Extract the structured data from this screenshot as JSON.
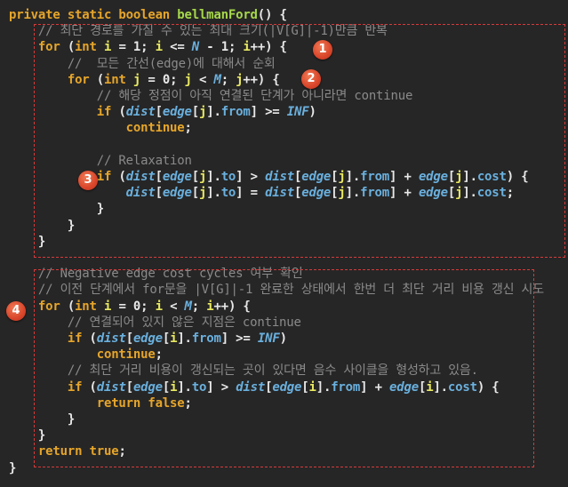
{
  "colors": {
    "background": "#262626",
    "keyword": "#e6a52a",
    "function": "#a6d84a",
    "variable": "#6ab0de",
    "index": "#e8e862",
    "comment": "#8a8a8a",
    "text": "#e8e8e8",
    "annotation": "#d83a3a"
  },
  "badges": [
    "1",
    "2",
    "3",
    "4"
  ],
  "lines": [
    [
      [
        "kw",
        "private static boolean "
      ],
      [
        "fn",
        "bellmanFord"
      ],
      [
        "punc",
        "() {"
      ]
    ],
    [
      [
        "cmt",
        "    // 최단 경로를 가질 수 있는 최대 크기(|V[G]|-1)만큼 반복"
      ]
    ],
    [
      [
        "punc",
        "    "
      ],
      [
        "kw",
        "for"
      ],
      [
        "punc",
        " ("
      ],
      [
        "kw",
        "int "
      ],
      [
        "idx",
        "i"
      ],
      [
        "op",
        " = "
      ],
      [
        "num",
        "1"
      ],
      [
        "punc",
        "; "
      ],
      [
        "idx",
        "i"
      ],
      [
        "op",
        " <= "
      ],
      [
        "var",
        "N"
      ],
      [
        "op",
        " - "
      ],
      [
        "num",
        "1"
      ],
      [
        "punc",
        "; "
      ],
      [
        "idx",
        "i"
      ],
      [
        "op",
        "++) {"
      ]
    ],
    [
      [
        "cmt",
        "        //  모든 간선(edge)에 대해서 순회"
      ]
    ],
    [
      [
        "punc",
        "        "
      ],
      [
        "kw",
        "for"
      ],
      [
        "punc",
        " ("
      ],
      [
        "kw",
        "int "
      ],
      [
        "idx",
        "j"
      ],
      [
        "op",
        " = "
      ],
      [
        "num",
        "0"
      ],
      [
        "punc",
        "; "
      ],
      [
        "idx",
        "j"
      ],
      [
        "op",
        " < "
      ],
      [
        "var",
        "M"
      ],
      [
        "punc",
        "; "
      ],
      [
        "idx",
        "j"
      ],
      [
        "op",
        "++) {"
      ]
    ],
    [
      [
        "cmt",
        "            // 해당 정점이 아직 연결된 단계가 아니라면 continue"
      ]
    ],
    [
      [
        "punc",
        "            "
      ],
      [
        "kw",
        "if"
      ],
      [
        "punc",
        " ("
      ],
      [
        "var",
        "dist"
      ],
      [
        "punc",
        "["
      ],
      [
        "var",
        "edge"
      ],
      [
        "punc",
        "["
      ],
      [
        "idx",
        "j"
      ],
      [
        "punc",
        "]."
      ],
      [
        "field",
        "from"
      ],
      [
        "punc",
        "] >= "
      ],
      [
        "var",
        "INF"
      ],
      [
        "punc",
        ")"
      ]
    ],
    [
      [
        "punc",
        "                "
      ],
      [
        "kw",
        "continue"
      ],
      [
        "punc",
        ";"
      ]
    ],
    [
      [
        "punc",
        " "
      ]
    ],
    [
      [
        "cmt",
        "            // Relaxation"
      ]
    ],
    [
      [
        "punc",
        "            "
      ],
      [
        "kw",
        "if"
      ],
      [
        "punc",
        " ("
      ],
      [
        "var",
        "dist"
      ],
      [
        "punc",
        "["
      ],
      [
        "var",
        "edge"
      ],
      [
        "punc",
        "["
      ],
      [
        "idx",
        "j"
      ],
      [
        "punc",
        "]."
      ],
      [
        "field",
        "to"
      ],
      [
        "punc",
        "] > "
      ],
      [
        "var",
        "dist"
      ],
      [
        "punc",
        "["
      ],
      [
        "var",
        "edge"
      ],
      [
        "punc",
        "["
      ],
      [
        "idx",
        "j"
      ],
      [
        "punc",
        "]."
      ],
      [
        "field",
        "from"
      ],
      [
        "punc",
        "] + "
      ],
      [
        "var",
        "edge"
      ],
      [
        "punc",
        "["
      ],
      [
        "idx",
        "j"
      ],
      [
        "punc",
        "]."
      ],
      [
        "field",
        "cost"
      ],
      [
        "punc",
        ") {"
      ]
    ],
    [
      [
        "punc",
        "                "
      ],
      [
        "var",
        "dist"
      ],
      [
        "punc",
        "["
      ],
      [
        "var",
        "edge"
      ],
      [
        "punc",
        "["
      ],
      [
        "idx",
        "j"
      ],
      [
        "punc",
        "]."
      ],
      [
        "field",
        "to"
      ],
      [
        "punc",
        "] = "
      ],
      [
        "var",
        "dist"
      ],
      [
        "punc",
        "["
      ],
      [
        "var",
        "edge"
      ],
      [
        "punc",
        "["
      ],
      [
        "idx",
        "j"
      ],
      [
        "punc",
        "]."
      ],
      [
        "field",
        "from"
      ],
      [
        "punc",
        "] + "
      ],
      [
        "var",
        "edge"
      ],
      [
        "punc",
        "["
      ],
      [
        "idx",
        "j"
      ],
      [
        "punc",
        "]."
      ],
      [
        "field",
        "cost"
      ],
      [
        "punc",
        ";"
      ]
    ],
    [
      [
        "punc",
        "            }"
      ]
    ],
    [
      [
        "punc",
        "        }"
      ]
    ],
    [
      [
        "punc",
        "    }"
      ]
    ],
    [
      [
        "punc",
        " "
      ]
    ],
    [
      [
        "cmt",
        "    // Negative edge cost cycles 여부 확인"
      ]
    ],
    [
      [
        "cmt",
        "    // 이전 단계에서 for문을 |V[G]|-1 완료한 상태에서 한번 더 최단 거리 비용 갱신 시도"
      ]
    ],
    [
      [
        "punc",
        "    "
      ],
      [
        "kw",
        "for"
      ],
      [
        "punc",
        " ("
      ],
      [
        "kw",
        "int "
      ],
      [
        "idx",
        "i"
      ],
      [
        "op",
        " = "
      ],
      [
        "num",
        "0"
      ],
      [
        "punc",
        "; "
      ],
      [
        "idx",
        "i"
      ],
      [
        "op",
        " < "
      ],
      [
        "var",
        "M"
      ],
      [
        "punc",
        "; "
      ],
      [
        "idx",
        "i"
      ],
      [
        "op",
        "++) {"
      ]
    ],
    [
      [
        "cmt",
        "        // 연결되어 있지 않은 지점은 continue"
      ]
    ],
    [
      [
        "punc",
        "        "
      ],
      [
        "kw",
        "if"
      ],
      [
        "punc",
        " ("
      ],
      [
        "var",
        "dist"
      ],
      [
        "punc",
        "["
      ],
      [
        "var",
        "edge"
      ],
      [
        "punc",
        "["
      ],
      [
        "idx",
        "i"
      ],
      [
        "punc",
        "]."
      ],
      [
        "field",
        "from"
      ],
      [
        "punc",
        "] >= "
      ],
      [
        "var",
        "INF"
      ],
      [
        "punc",
        ")"
      ]
    ],
    [
      [
        "punc",
        "            "
      ],
      [
        "kw",
        "continue"
      ],
      [
        "punc",
        ";"
      ]
    ],
    [
      [
        "cmt",
        "        // 최단 거리 비용이 갱신되는 곳이 있다면 음수 사이클을 형성하고 있음."
      ]
    ],
    [
      [
        "punc",
        "        "
      ],
      [
        "kw",
        "if"
      ],
      [
        "punc",
        " ("
      ],
      [
        "var",
        "dist"
      ],
      [
        "punc",
        "["
      ],
      [
        "var",
        "edge"
      ],
      [
        "punc",
        "["
      ],
      [
        "idx",
        "i"
      ],
      [
        "punc",
        "]."
      ],
      [
        "field",
        "to"
      ],
      [
        "punc",
        "] > "
      ],
      [
        "var",
        "dist"
      ],
      [
        "punc",
        "["
      ],
      [
        "var",
        "edge"
      ],
      [
        "punc",
        "["
      ],
      [
        "idx",
        "i"
      ],
      [
        "punc",
        "]."
      ],
      [
        "field",
        "from"
      ],
      [
        "punc",
        "] + "
      ],
      [
        "var",
        "edge"
      ],
      [
        "punc",
        "["
      ],
      [
        "idx",
        "i"
      ],
      [
        "punc",
        "]."
      ],
      [
        "field",
        "cost"
      ],
      [
        "punc",
        ") {"
      ]
    ],
    [
      [
        "punc",
        "            "
      ],
      [
        "kw",
        "return false"
      ],
      [
        "punc",
        ";"
      ]
    ],
    [
      [
        "punc",
        "        }"
      ]
    ],
    [
      [
        "punc",
        "    }"
      ]
    ],
    [
      [
        "punc",
        "    "
      ],
      [
        "kw",
        "return true"
      ],
      [
        "punc",
        ";"
      ]
    ],
    [
      [
        "punc",
        "}"
      ]
    ]
  ]
}
